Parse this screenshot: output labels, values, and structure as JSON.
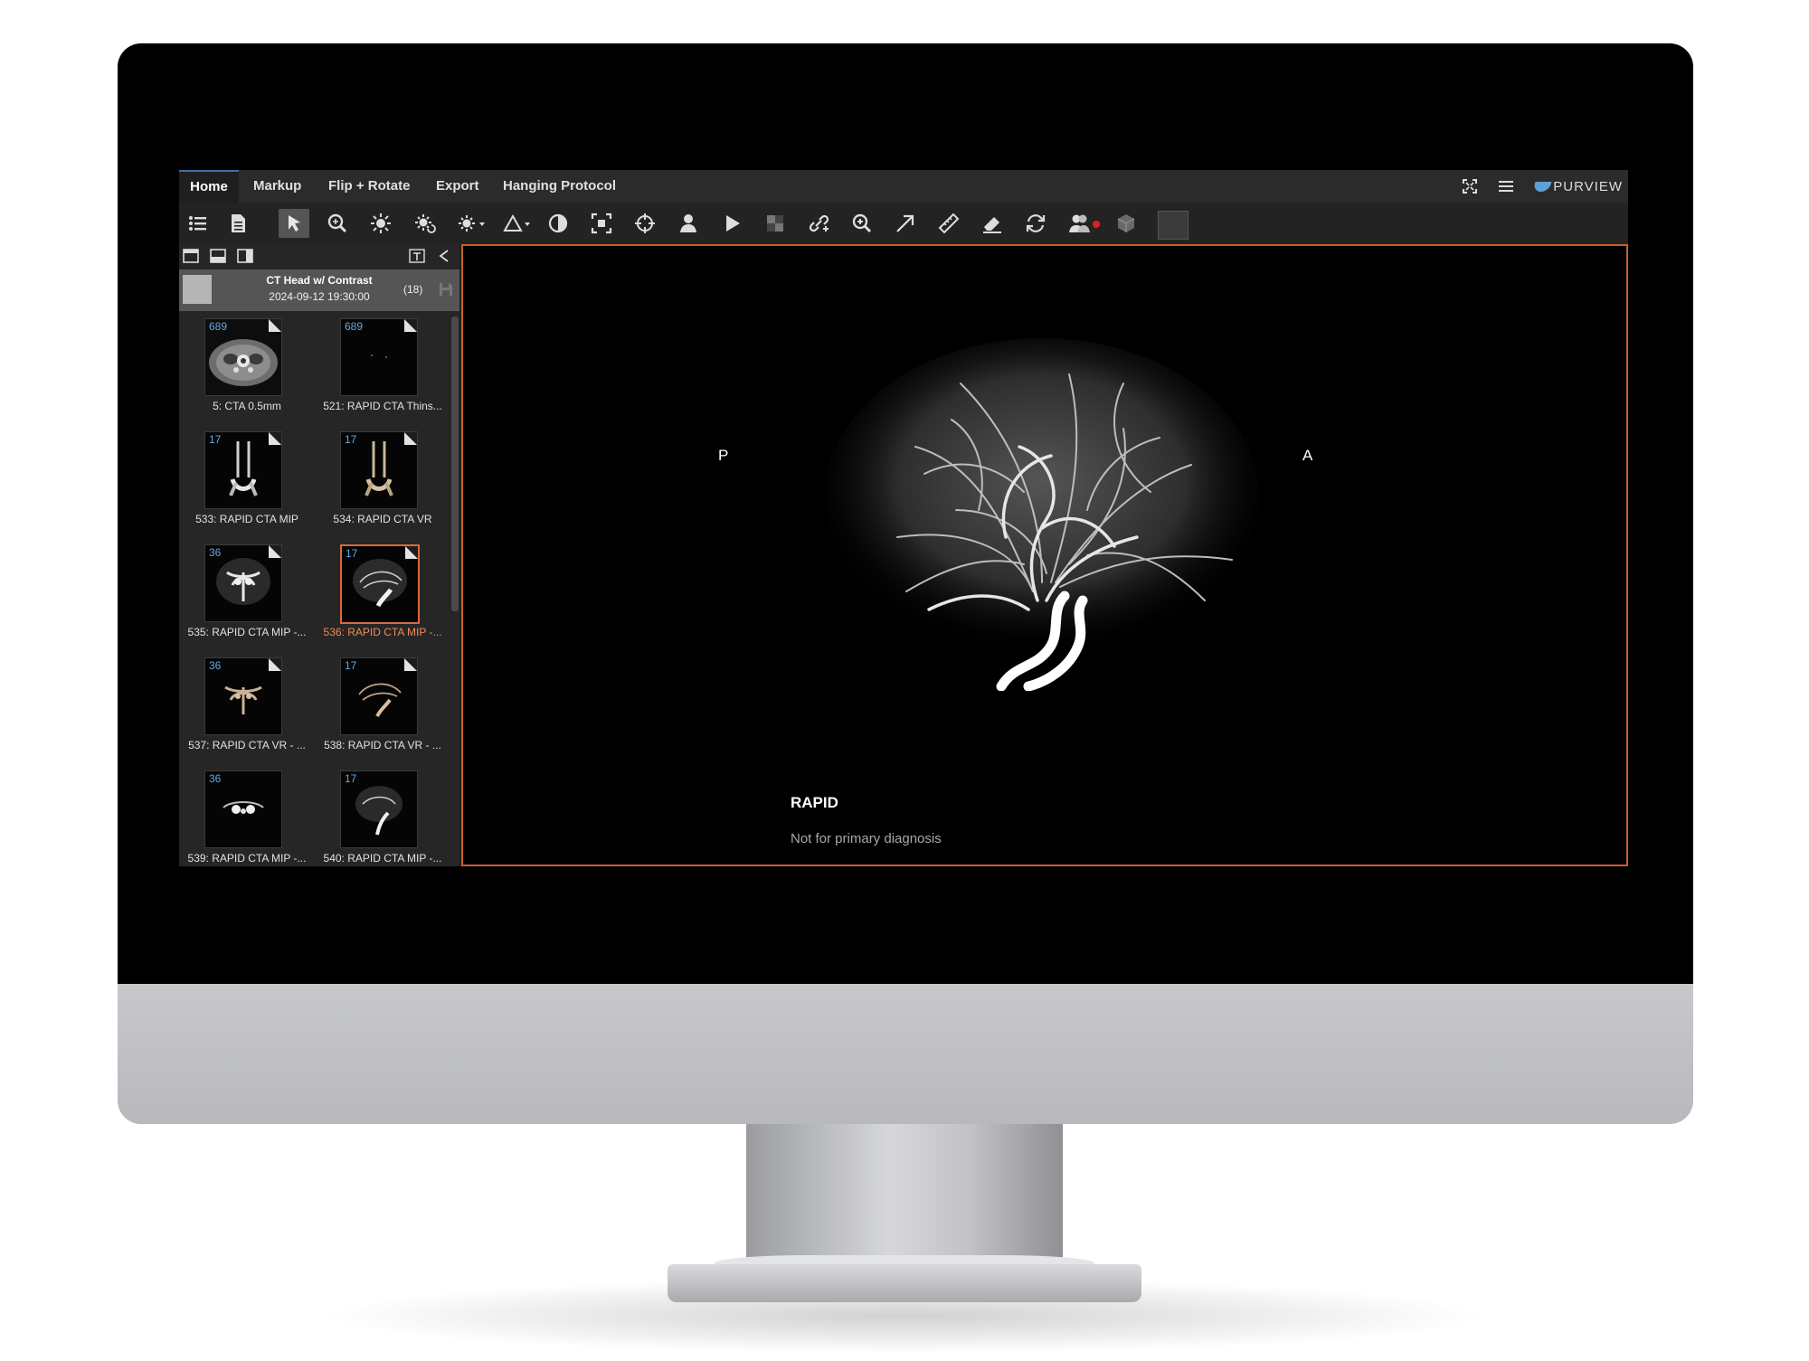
{
  "menu": {
    "tabs": [
      {
        "label": "Home",
        "active": true
      },
      {
        "label": "Markup",
        "active": false
      },
      {
        "label": "Flip + Rotate",
        "active": false
      },
      {
        "label": "Export",
        "active": false
      },
      {
        "label": "Hanging Protocol",
        "active": false
      }
    ],
    "brand": "PURVIEW",
    "right_icons": [
      "fullscreen-icon",
      "hamburger-menu-icon"
    ]
  },
  "toolbar": {
    "tools": [
      "list-icon",
      "document-icon",
      "pointer-icon",
      "zoom-search-icon",
      "brightness-icon",
      "auto-window-icon",
      "window-preset-icon",
      "shape-icon",
      "contrast-icon",
      "fit-icon",
      "crosshair-icon",
      "user-icon",
      "play-icon",
      "layout-icon",
      "link-icon",
      "magnifier-icon",
      "arrow-icon",
      "ruler-icon",
      "eraser-icon",
      "cycle-icon",
      "users-icon",
      "cube-icon"
    ],
    "selected_tool": "pointer-icon",
    "record_indicator_color": "#e02020"
  },
  "study": {
    "title": "CT Head w/ Contrast",
    "date": "2024-09-12 19:30:00",
    "count": "(18)"
  },
  "series": [
    {
      "count": "689",
      "label": "5: CTA 0.5mm",
      "active": false
    },
    {
      "count": "689",
      "label": "521: RAPID CTA Thins...",
      "active": false
    },
    {
      "count": "17",
      "label": "533: RAPID CTA MIP",
      "active": false
    },
    {
      "count": "17",
      "label": "534: RAPID CTA VR",
      "active": false
    },
    {
      "count": "36",
      "label": "535: RAPID CTA MIP -...",
      "active": false
    },
    {
      "count": "17",
      "label": "536: RAPID CTA MIP -...",
      "active": true
    },
    {
      "count": "36",
      "label": "537: RAPID CTA VR - ...",
      "active": false
    },
    {
      "count": "17",
      "label": "538: RAPID CTA VR - ...",
      "active": false
    },
    {
      "count": "36",
      "label": "539: RAPID CTA MIP -...",
      "active": false
    },
    {
      "count": "17",
      "label": "540: RAPID CTA MIP -...",
      "active": false
    }
  ],
  "viewport": {
    "orientation_left": "P",
    "orientation_right": "A",
    "title": "RAPID",
    "subtitle": "Not for primary diagnosis"
  },
  "colors": {
    "accent_active": "#d86b3a",
    "count_blue": "#5fa8e6"
  }
}
